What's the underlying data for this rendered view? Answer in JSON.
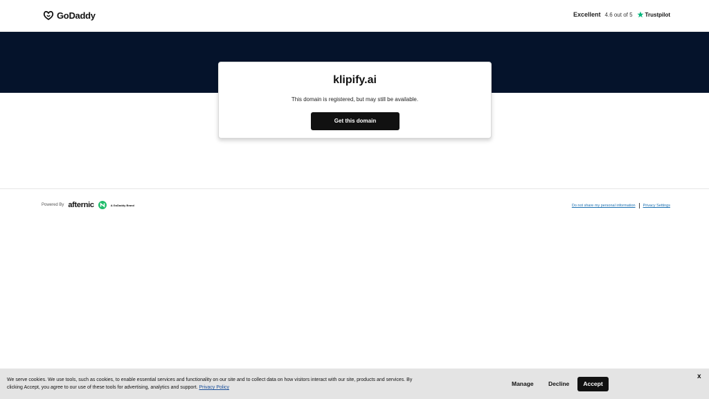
{
  "header": {
    "logo_text": "GoDaddy",
    "rating_label": "Excellent",
    "rating_value": "4.6 out of 5",
    "trustpilot": "Trustpilot"
  },
  "card": {
    "domain": "klipify.ai",
    "subtitle": "This domain is registered, but may still be available.",
    "cta": "Get this domain"
  },
  "footer": {
    "powered_by": "Powered By",
    "partner": "afternic",
    "brand_note": "A GoDaddy Brand",
    "links": [
      "Do not share my personal information",
      "Privacy Settings"
    ]
  },
  "cookie": {
    "text_line1": "We serve cookies. We use tools, such as cookies, to enable essential services and functionality on our site and to collect data on how visitors interact with our site, products and",
    "text_line2": "services. By clicking Accept, you agree to our use of these tools for advertising, analytics and support.",
    "privacy_link": "Privacy Policy",
    "manage": "Manage",
    "decline": "Decline",
    "accept": "Accept",
    "close": "x"
  },
  "colors": {
    "banner": "#05132b",
    "button": "#111111",
    "trustpilot_star": "#00b67a",
    "afternic_green": "#1fbd6b"
  }
}
